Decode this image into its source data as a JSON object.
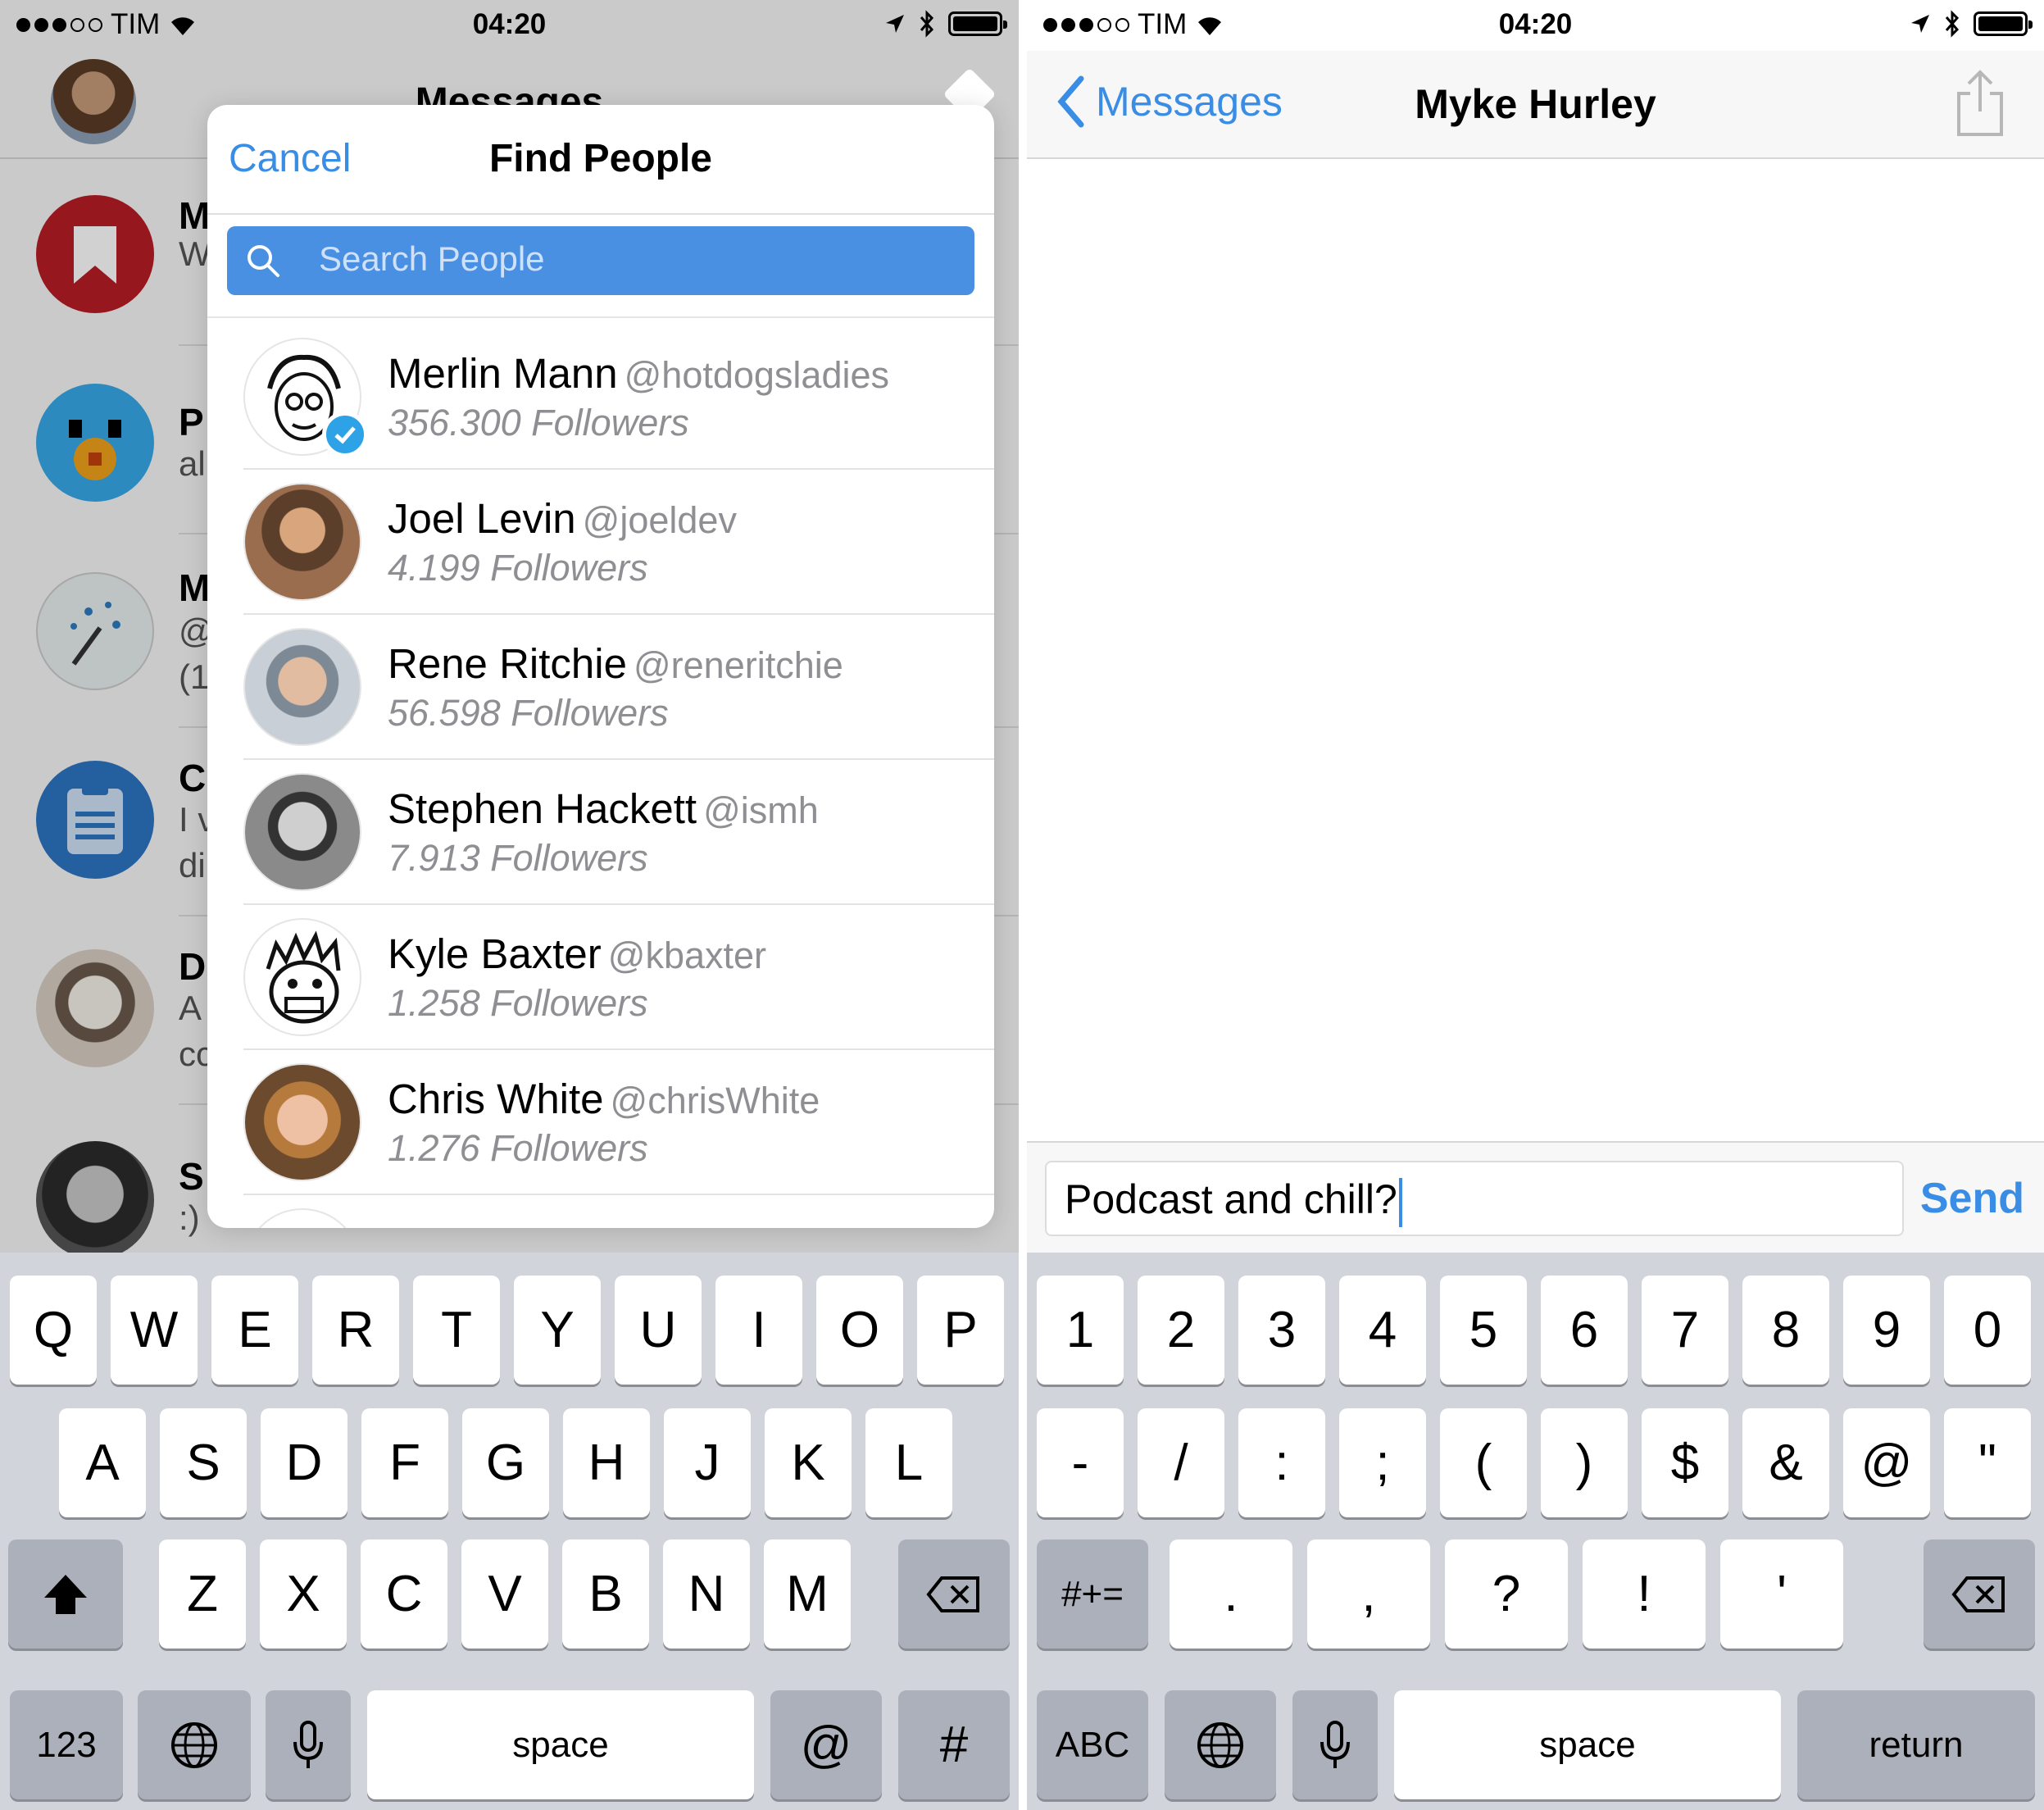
{
  "status": {
    "carrier": "TIM",
    "time": "04:20"
  },
  "left": {
    "nav_title": "Messages",
    "conversations": [
      {
        "initial": "M",
        "preview": "W"
      },
      {
        "initial": "P",
        "preview": "al"
      },
      {
        "initial": "M",
        "preview": "@",
        "extra": "(1"
      },
      {
        "initial": "C",
        "preview": "I v",
        "extra": "di"
      },
      {
        "initial": "D",
        "preview": "A",
        "extra": "cc"
      },
      {
        "initial": "S",
        "preview": ":)"
      }
    ],
    "popover": {
      "cancel": "Cancel",
      "title": "Find People",
      "search_placeholder": "Search People",
      "people": [
        {
          "name": "Merlin Mann",
          "handle": "@hotdogsladies",
          "followers": "356.300 Followers",
          "verified": true
        },
        {
          "name": "Joel Levin",
          "handle": "@joeldev",
          "followers": "4.199 Followers"
        },
        {
          "name": "Rene Ritchie",
          "handle": "@reneritchie",
          "followers": "56.598 Followers"
        },
        {
          "name": "Stephen Hackett",
          "handle": "@ismh",
          "followers": "7.913 Followers"
        },
        {
          "name": "Kyle Baxter",
          "handle": "@kbaxter",
          "followers": "1.258 Followers"
        },
        {
          "name": "Chris White",
          "handle": "@chrisWhite",
          "followers": "1.276 Followers"
        }
      ]
    },
    "keyboard": {
      "row1": [
        "Q",
        "W",
        "E",
        "R",
        "T",
        "Y",
        "U",
        "I",
        "O",
        "P"
      ],
      "row2": [
        "A",
        "S",
        "D",
        "F",
        "G",
        "H",
        "J",
        "K",
        "L"
      ],
      "row3": [
        "Z",
        "X",
        "C",
        "V",
        "B",
        "N",
        "M"
      ],
      "numbers_key": "123",
      "space": "space",
      "at": "@",
      "hash": "#"
    }
  },
  "right": {
    "back_label": "Messages",
    "title": "Myke Hurley",
    "message_text": "Podcast and chill?",
    "send": "Send",
    "keyboard": {
      "row1": [
        "1",
        "2",
        "3",
        "4",
        "5",
        "6",
        "7",
        "8",
        "9",
        "0"
      ],
      "row2": [
        "-",
        "/",
        ":",
        ";",
        "(",
        ")",
        "$",
        "&",
        "@",
        "\""
      ],
      "row3": [
        ".",
        ",",
        "?",
        "!",
        "'"
      ],
      "symbols_key": "#+=",
      "abc_key": "ABC",
      "space": "space",
      "return": "return"
    }
  },
  "colors": {
    "accent": "#3a8de5",
    "search_bg": "#4a90e2",
    "keyboard_bg": "#d1d4da"
  }
}
